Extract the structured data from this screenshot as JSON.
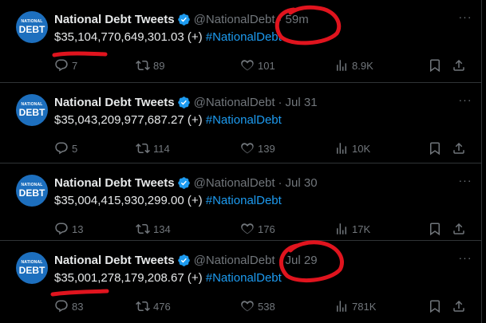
{
  "accent": "#1d9bf0",
  "annotation_color": "#e0141e",
  "more_label": "···",
  "tweets": [
    {
      "name": "National Debt Tweets",
      "handle": "@NationalDebt",
      "separator": "·",
      "time": "59m",
      "amount": "$35,104,770,649,301.03 (+)",
      "hashtag": "#NationalDebt",
      "replies": "7",
      "retweets": "89",
      "likes": "101",
      "views": "8.9K",
      "avatar_top": "NATIONAL",
      "avatar_bottom": "DEBT"
    },
    {
      "name": "National Debt Tweets",
      "handle": "@NationalDebt",
      "separator": "·",
      "time": "Jul 31",
      "amount": "$35,043,209,977,687.27 (+)",
      "hashtag": "#NationalDebt",
      "replies": "5",
      "retweets": "114",
      "likes": "139",
      "views": "10K",
      "avatar_top": "NATIONAL",
      "avatar_bottom": "DEBT"
    },
    {
      "name": "National Debt Tweets",
      "handle": "@NationalDebt",
      "separator": "·",
      "time": "Jul 30",
      "amount": "$35,004,415,930,299.00 (+)",
      "hashtag": "#NationalDebt",
      "replies": "13",
      "retweets": "134",
      "likes": "176",
      "views": "17K",
      "avatar_top": "NATIONAL",
      "avatar_bottom": "DEBT"
    },
    {
      "name": "National Debt Tweets",
      "handle": "@NationalDebt",
      "separator": "·",
      "time": "Jul 29",
      "amount": "$35,001,278,179,208.67 (+)",
      "hashtag": "#NationalDebt",
      "replies": "83",
      "retweets": "476",
      "likes": "538",
      "views": "781K",
      "avatar_top": "NATIONAL",
      "avatar_bottom": "DEBT"
    }
  ]
}
